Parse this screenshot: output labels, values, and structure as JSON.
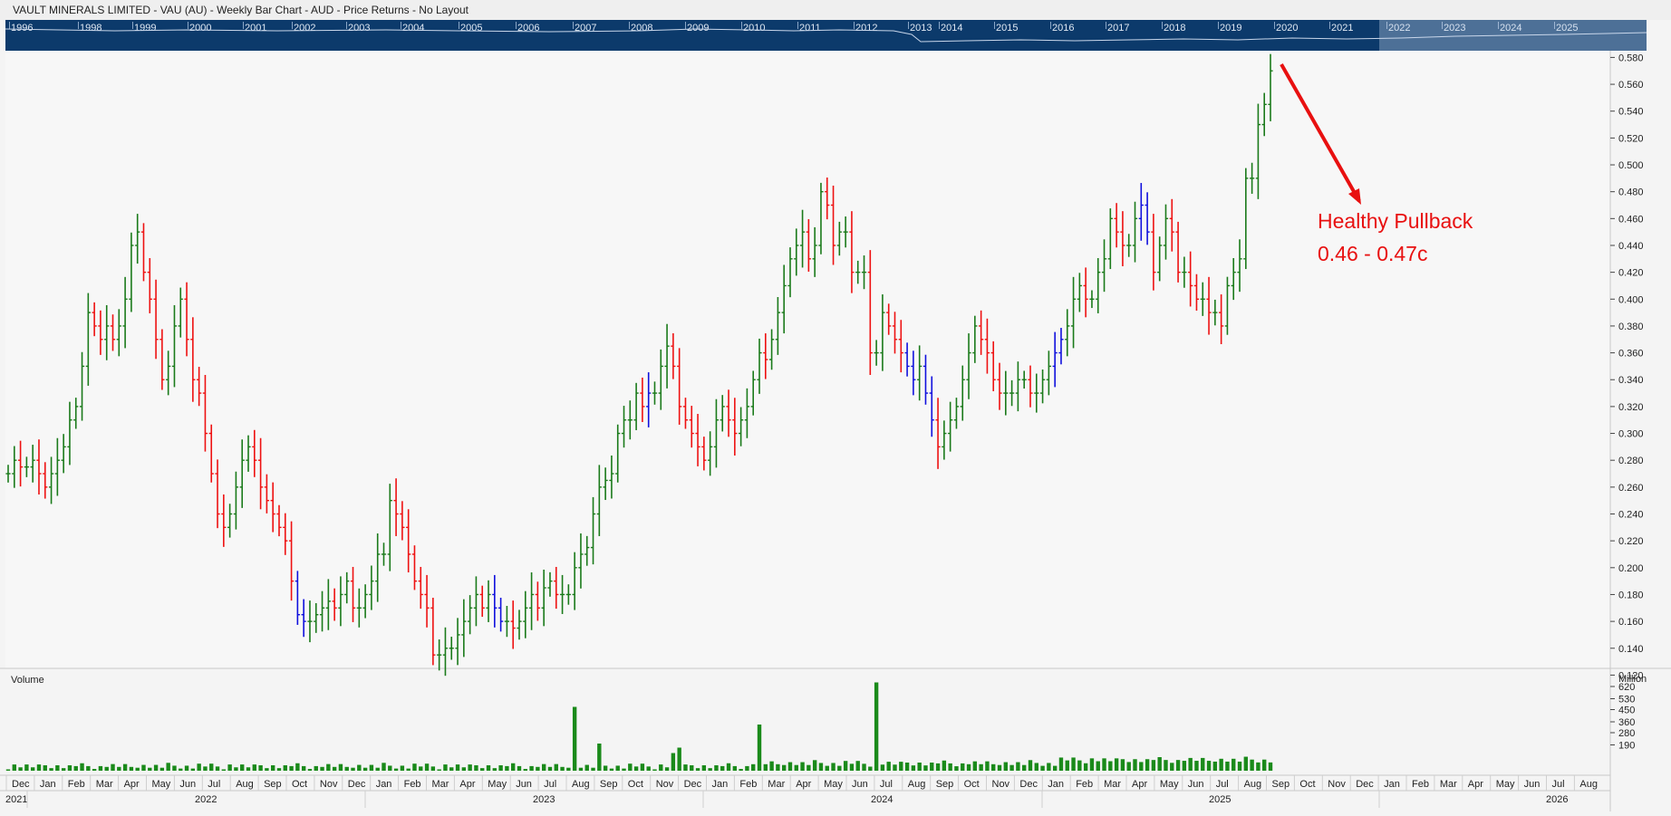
{
  "window": {
    "title": "VAULT MINERALS LIMITED - VAU (AU) - Weekly Bar Chart - AUD - Price Returns - No Layout"
  },
  "navigator": {
    "years": [
      "1996",
      "1998",
      "1999",
      "2000",
      "2001",
      "2002",
      "2003",
      "2004",
      "2005",
      "2006",
      "2007",
      "2008",
      "2009",
      "2010",
      "2011",
      "2012",
      "2013",
      "2014",
      "2015",
      "2016",
      "2017",
      "2018",
      "2019",
      "2020",
      "2021",
      "2022",
      "2023",
      "2024",
      "2025"
    ]
  },
  "colors": {
    "up": "#1a7a1a",
    "down": "#ee1111",
    "other": "#1010dd",
    "volume": "#1a8a1a",
    "annotation": "#e81010",
    "navigator_bg": "#0c3a6b"
  },
  "annotation": {
    "line1": "Healthy Pullback",
    "line2": "0.46 - 0.47c"
  },
  "volume_panel": {
    "title": "Volume",
    "unit": "Million"
  },
  "chart_data": [
    {
      "type": "bar",
      "series_kind": "ohlc-weekly",
      "title": "VAULT MINERALS LIMITED - VAU (AU) - Weekly Bar Chart - AUD - Price Returns - No Layout",
      "ylim": [
        0.125,
        0.585
      ],
      "y_ticks": [
        "0.580",
        "0.560",
        "0.540",
        "0.520",
        "0.500",
        "0.480",
        "0.460",
        "0.440",
        "0.420",
        "0.400",
        "0.380",
        "0.360",
        "0.340",
        "0.320",
        "0.300",
        "0.280",
        "0.260",
        "0.240",
        "0.220",
        "0.200",
        "0.180",
        "0.160",
        "0.140",
        "0.120"
      ],
      "x_months": [
        "Dec",
        "Jan",
        "Feb",
        "Mar",
        "Apr",
        "May",
        "Jun",
        "Jul",
        "Aug",
        "Sep",
        "Oct",
        "Nov",
        "Dec",
        "Jan",
        "Feb",
        "Mar",
        "Apr",
        "May",
        "Jun",
        "Jul",
        "Aug",
        "Sep",
        "Oct",
        "Nov",
        "Dec",
        "Jan",
        "Feb",
        "Mar",
        "Apr",
        "May",
        "Jun",
        "Jul",
        "Aug",
        "Sep",
        "Oct",
        "Nov",
        "Dec",
        "Jan",
        "Feb",
        "Mar",
        "Apr",
        "May",
        "Jun",
        "Jul",
        "Aug",
        "Sep",
        "Oct",
        "Nov",
        "Dec",
        "Jan",
        "Feb",
        "Mar",
        "Apr",
        "May",
        "Jun",
        "Jul",
        "Aug"
      ],
      "x_years": [
        "2021",
        "2022",
        "2023",
        "2024",
        "2025",
        "2026"
      ],
      "grid": false,
      "closes": [
        0.27,
        0.28,
        0.275,
        0.275,
        0.28,
        0.27,
        0.26,
        0.27,
        0.28,
        0.29,
        0.31,
        0.32,
        0.35,
        0.39,
        0.38,
        0.37,
        0.38,
        0.37,
        0.38,
        0.4,
        0.44,
        0.45,
        0.42,
        0.4,
        0.37,
        0.34,
        0.35,
        0.38,
        0.4,
        0.37,
        0.34,
        0.33,
        0.3,
        0.27,
        0.24,
        0.23,
        0.24,
        0.26,
        0.28,
        0.29,
        0.28,
        0.26,
        0.25,
        0.24,
        0.23,
        0.22,
        0.19,
        0.165,
        0.16,
        0.16,
        0.165,
        0.17,
        0.175,
        0.17,
        0.18,
        0.19,
        0.17,
        0.17,
        0.18,
        0.19,
        0.21,
        0.21,
        0.25,
        0.24,
        0.23,
        0.21,
        0.19,
        0.18,
        0.17,
        0.135,
        0.135,
        0.14,
        0.14,
        0.15,
        0.16,
        0.17,
        0.18,
        0.17,
        0.18,
        0.17,
        0.16,
        0.16,
        0.155,
        0.16,
        0.17,
        0.18,
        0.17,
        0.185,
        0.19,
        0.18,
        0.18,
        0.18,
        0.2,
        0.21,
        0.215,
        0.24,
        0.26,
        0.265,
        0.27,
        0.3,
        0.31,
        0.31,
        0.33,
        0.32,
        0.33,
        0.33,
        0.35,
        0.365,
        0.35,
        0.32,
        0.31,
        0.3,
        0.29,
        0.28,
        0.29,
        0.31,
        0.32,
        0.31,
        0.3,
        0.31,
        0.32,
        0.34,
        0.36,
        0.355,
        0.37,
        0.39,
        0.41,
        0.43,
        0.44,
        0.45,
        0.43,
        0.44,
        0.48,
        0.47,
        0.44,
        0.45,
        0.45,
        0.42,
        0.42,
        0.42,
        0.36,
        0.36,
        0.39,
        0.38,
        0.37,
        0.36,
        0.35,
        0.34,
        0.35,
        0.33,
        0.31,
        0.29,
        0.3,
        0.31,
        0.32,
        0.34,
        0.36,
        0.38,
        0.37,
        0.36,
        0.34,
        0.33,
        0.33,
        0.33,
        0.34,
        0.34,
        0.33,
        0.33,
        0.34,
        0.35,
        0.36,
        0.37,
        0.38,
        0.4,
        0.41,
        0.4,
        0.4,
        0.42,
        0.43,
        0.46,
        0.45,
        0.44,
        0.44,
        0.46,
        0.47,
        0.45,
        0.42,
        0.44,
        0.46,
        0.45,
        0.42,
        0.42,
        0.41,
        0.4,
        0.4,
        0.39,
        0.39,
        0.38,
        0.41,
        0.42,
        0.43,
        0.49,
        0.49,
        0.53,
        0.545,
        0.57
      ]
    },
    {
      "type": "bar",
      "title": "Volume",
      "unit": "Million",
      "ylim": [
        0,
        700
      ],
      "y_ticks": [
        "620",
        "530",
        "450",
        "360",
        "280",
        "190"
      ]
    }
  ]
}
